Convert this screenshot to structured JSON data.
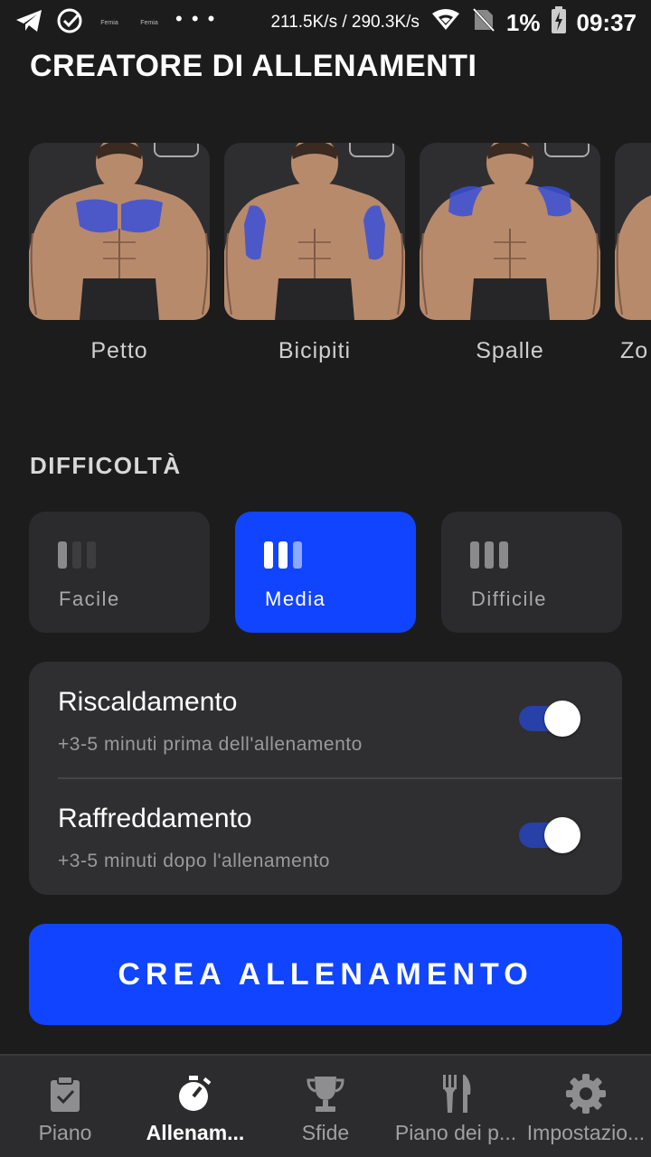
{
  "status_bar": {
    "app1": "Femia",
    "app2": "Femia",
    "dots": "• • •",
    "network_speed": "211.5K/s / 290.3K/s",
    "battery": "1%",
    "time": "09:37"
  },
  "header": {
    "title": "CREATORE DI ALLENAMENTI"
  },
  "muscles": [
    {
      "label": "Petto",
      "highlight": "chest"
    },
    {
      "label": "Bicipiti",
      "highlight": "biceps"
    },
    {
      "label": "Spalle",
      "highlight": "shoulders"
    },
    {
      "label": "Zo",
      "highlight": "none"
    }
  ],
  "difficulty": {
    "title": "DIFFICOLTÀ",
    "options": [
      {
        "label": "Facile",
        "level": 1
      },
      {
        "label": "Media",
        "level": 2,
        "selected": true
      },
      {
        "label": "Difficile",
        "level": 3
      }
    ]
  },
  "toggles": [
    {
      "title": "Riscaldamento",
      "subtitle": "+3-5 minuti prima dell'allenamento",
      "on": true
    },
    {
      "title": "Raffreddamento",
      "subtitle": "+3-5 minuti dopo l'allenamento",
      "on": true
    }
  ],
  "cta": {
    "label": "CREA ALLENAMENTO"
  },
  "bottom_nav": [
    {
      "label": "Piano",
      "icon": "clipboard-icon"
    },
    {
      "label": "Allenam...",
      "icon": "stopwatch-icon",
      "active": true
    },
    {
      "label": "Sfide",
      "icon": "trophy-icon"
    },
    {
      "label": "Piano dei p...",
      "icon": "utensils-icon"
    },
    {
      "label": "Impostazio...",
      "icon": "gear-icon"
    }
  ],
  "colors": {
    "background": "#1c1c1d",
    "accent": "#1144ff",
    "card": "#2f2f31",
    "muscle_highlight": "#3a4fd8"
  }
}
